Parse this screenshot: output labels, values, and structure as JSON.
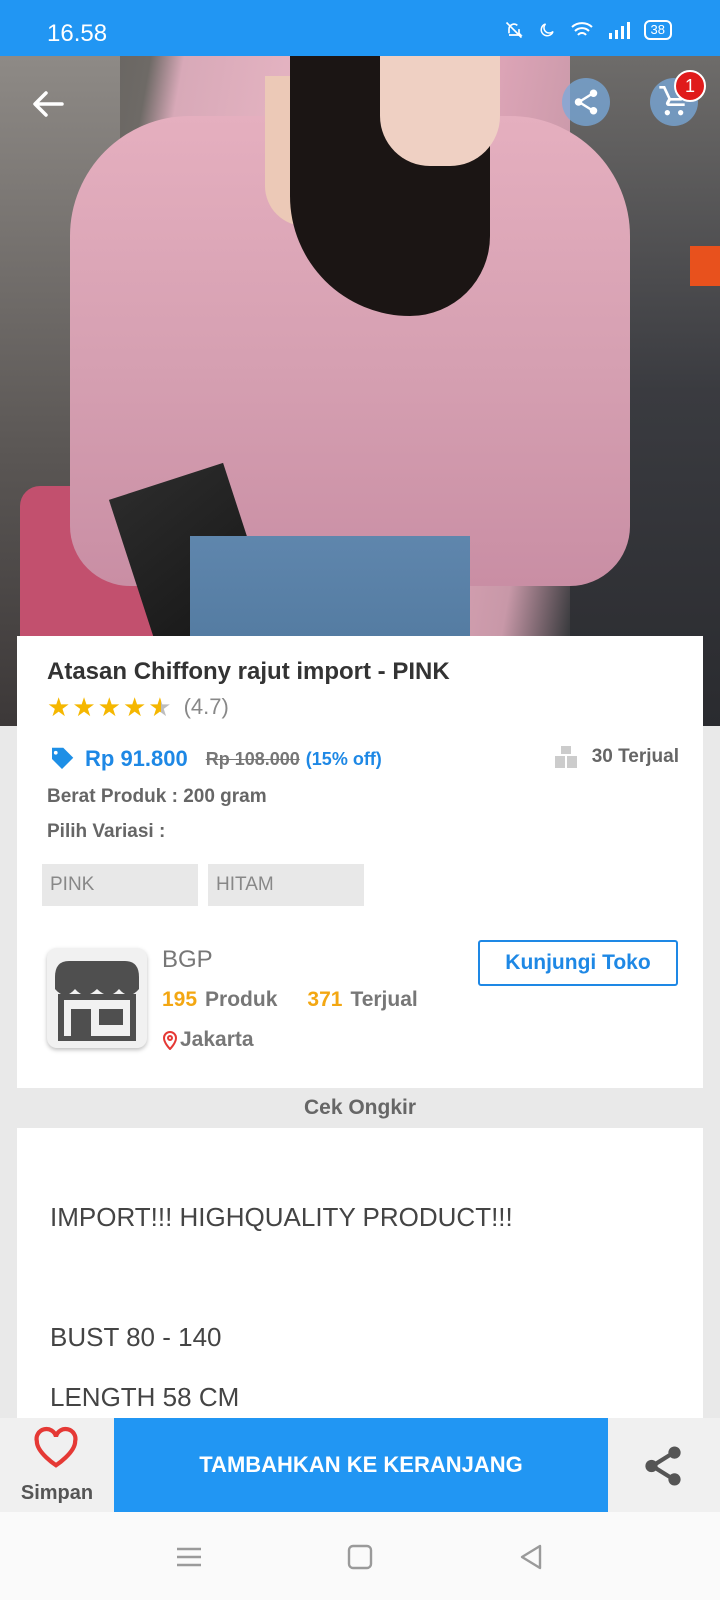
{
  "status_bar": {
    "time": "16.58",
    "battery": "38"
  },
  "header": {
    "cart_count": "1"
  },
  "product": {
    "title": "Atasan Chiffony rajut import - PINK",
    "rating": 4.7,
    "rating_text": "(4.7)",
    "price": "Rp 91.800",
    "old_price": "Rp 108.000",
    "discount": "(15% off)",
    "sold": "30 Terjual",
    "weight": "Berat Produk : 200 gram",
    "variant_label": "Pilih Variasi :",
    "variants": [
      "PINK",
      "HITAM"
    ]
  },
  "store": {
    "name": "BGP",
    "products_count": "195",
    "products_label": "Produk",
    "sold_count": "371",
    "sold_label": "Terjual",
    "location": "Jakarta",
    "visit_label": "Kunjungi Toko"
  },
  "shipping": {
    "label": "Cek Ongkir"
  },
  "description": {
    "lines": [
      "IMPORT!!! HIGHQUALITY PRODUCT!!!",
      "BUST 80 - 140",
      "LENGTH 58 CM"
    ]
  },
  "actions": {
    "save_label": "Simpan",
    "add_to_cart_label": "TAMBAHKAN KE KERANJANG"
  },
  "colors": {
    "primary": "#2196f3",
    "accent_orange": "#f3a712",
    "badge_red": "#e01b1b",
    "star": "#f5b700"
  },
  "icons": [
    "back-arrow-icon",
    "share-icon",
    "cart-icon",
    "star-icon",
    "price-tag-icon",
    "store-icon",
    "location-pin-icon",
    "heart-icon",
    "menu-icon",
    "home-icon",
    "back-triangle-icon"
  ]
}
